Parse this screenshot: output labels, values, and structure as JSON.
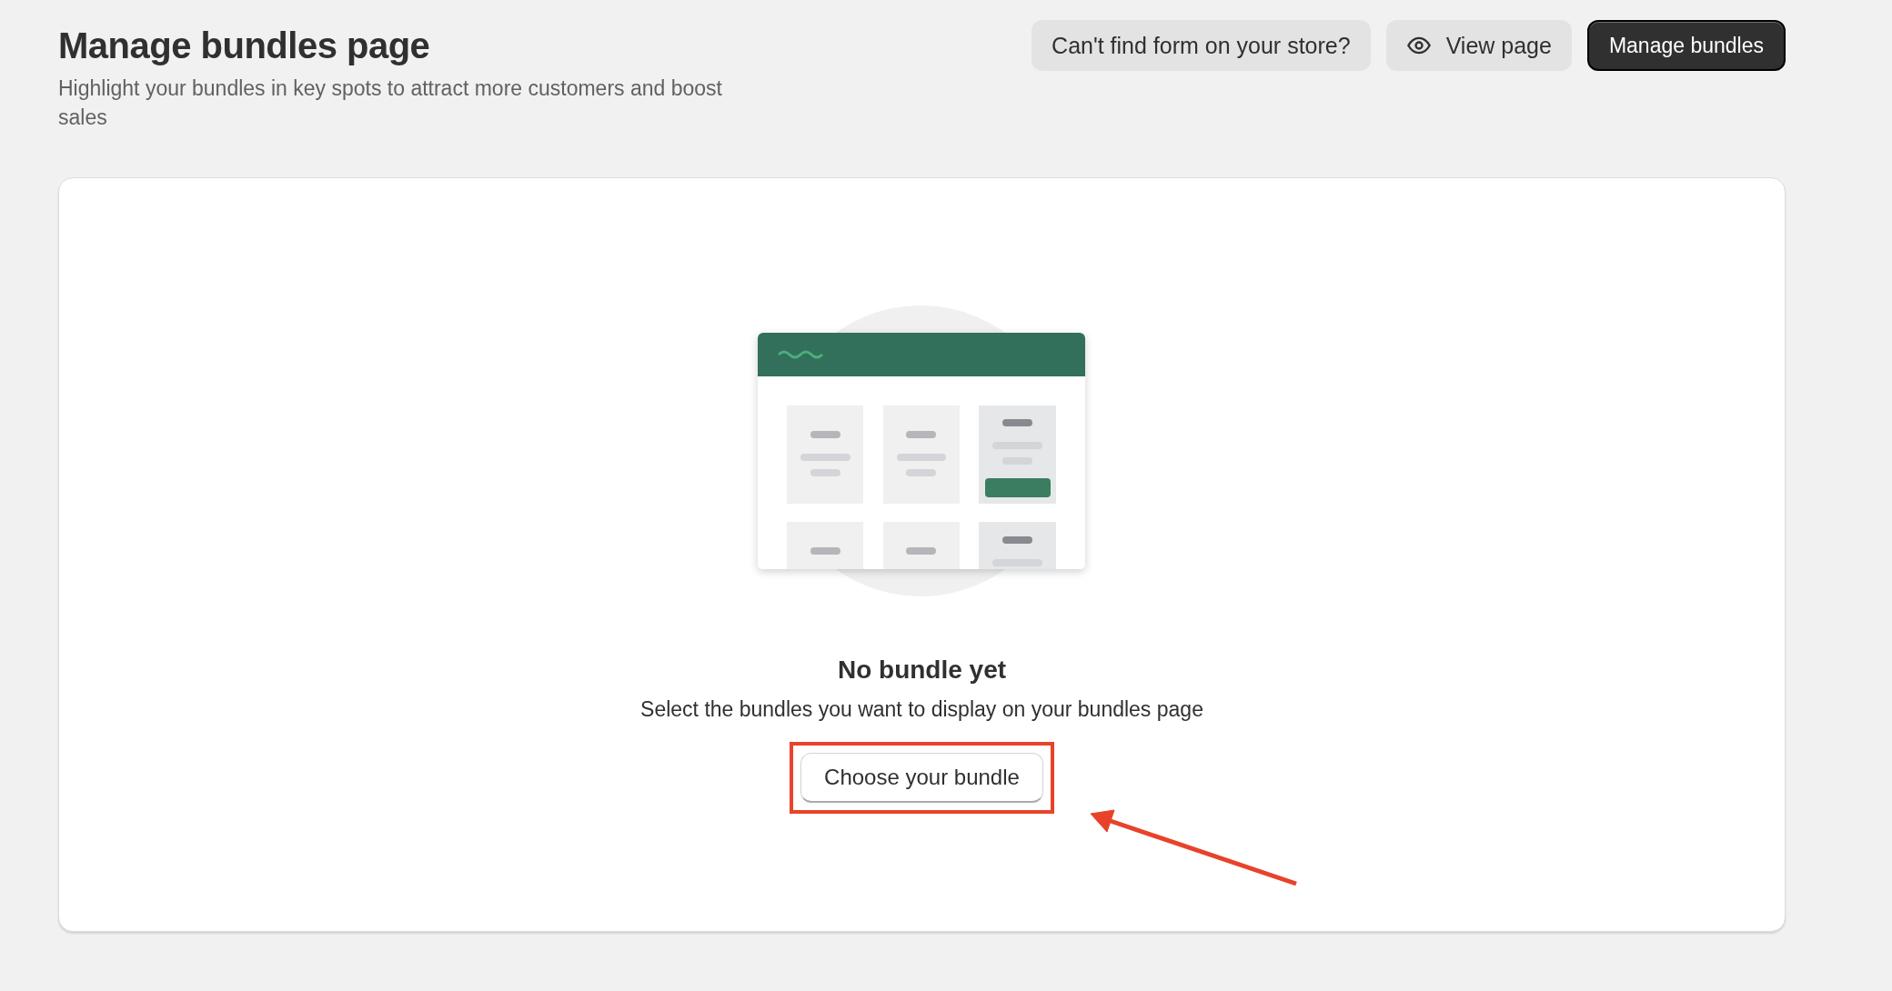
{
  "header": {
    "title": "Manage bundles page",
    "subtitle": "Highlight your bundles in key spots to attract more customers and boost sales"
  },
  "actions": [
    {
      "kind": "secondary",
      "label": "Can't find form on your store?"
    },
    {
      "kind": "preview",
      "label": "View page"
    },
    {
      "kind": "primary",
      "label": "Manage bundles"
    }
  ],
  "empty_state": {
    "heading": "No bundle yet",
    "description": "Select the bundles you want to display on your bundles page",
    "button": "Choose your bundle"
  },
  "annotation": {
    "color": "#e8432a"
  }
}
